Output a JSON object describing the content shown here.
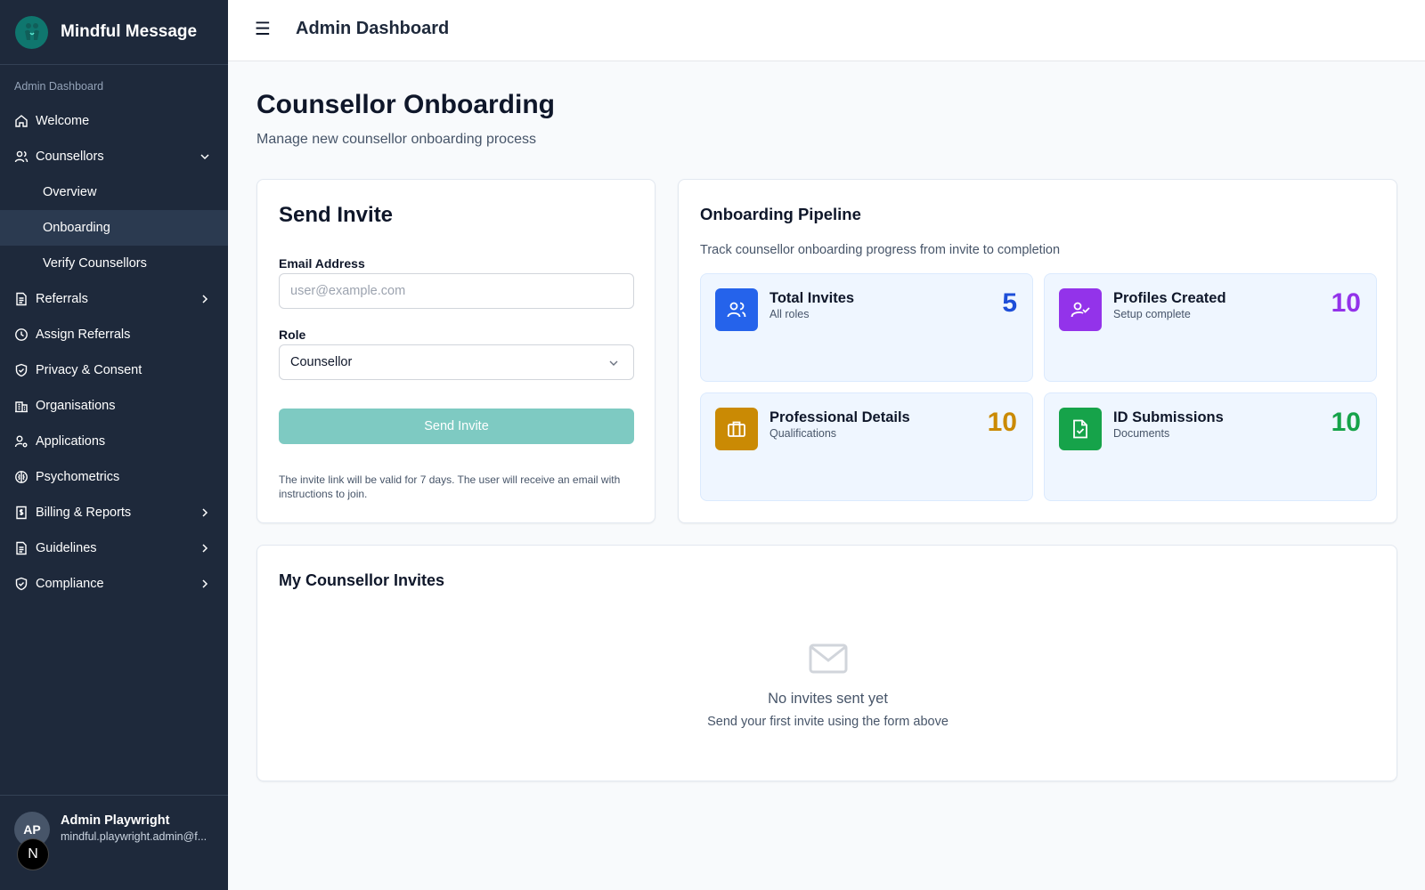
{
  "brand": {
    "name": "Mindful Message"
  },
  "sidebar": {
    "section_label": "Admin Dashboard",
    "items": {
      "welcome": "Welcome",
      "counsellors": "Counsellors",
      "overview": "Overview",
      "onboarding": "Onboarding",
      "verify": "Verify Counsellors",
      "referrals": "Referrals",
      "assign_referrals": "Assign Referrals",
      "privacy": "Privacy & Consent",
      "organisations": "Organisations",
      "applications": "Applications",
      "psychometrics": "Psychometrics",
      "billing": "Billing & Reports",
      "guidelines": "Guidelines",
      "compliance": "Compliance"
    },
    "user": {
      "initials": "AP",
      "name": "Admin Playwright",
      "email": "mindful.playwright.admin@f...",
      "badge": "N"
    }
  },
  "topbar": {
    "title": "Admin Dashboard"
  },
  "page": {
    "title": "Counsellor Onboarding",
    "subtitle": "Manage new counsellor onboarding process"
  },
  "invite": {
    "title": "Send Invite",
    "email_label": "Email Address",
    "email_placeholder": "user@example.com",
    "role_label": "Role",
    "role_value": "Counsellor",
    "button": "Send Invite",
    "note": "The invite link will be valid for 7 days. The user will receive an email with instructions to join."
  },
  "pipeline": {
    "title": "Onboarding Pipeline",
    "subtitle": "Track counsellor onboarding progress from invite to completion",
    "stats": [
      {
        "label": "Total Invites",
        "sub": "All roles",
        "value": "5",
        "color": "#1d4ed8",
        "icon_bg": "#2563eb",
        "icon": "users-icon"
      },
      {
        "label": "Profiles Created",
        "sub": "Setup complete",
        "value": "10",
        "color": "#9333ea",
        "icon_bg": "#9333ea",
        "icon": "user-check-icon"
      },
      {
        "label": "Professional Details",
        "sub": "Qualifications",
        "value": "10",
        "color": "#ca8a04",
        "icon_bg": "#ca8a04",
        "icon": "briefcase-icon"
      },
      {
        "label": "ID Submissions",
        "sub": "Documents",
        "value": "10",
        "color": "#16a34a",
        "icon_bg": "#16a34a",
        "icon": "file-check-icon"
      }
    ]
  },
  "my_invites": {
    "title": "My Counsellor Invites",
    "empty_title": "No invites sent yet",
    "empty_sub": "Send your first invite using the form above"
  }
}
